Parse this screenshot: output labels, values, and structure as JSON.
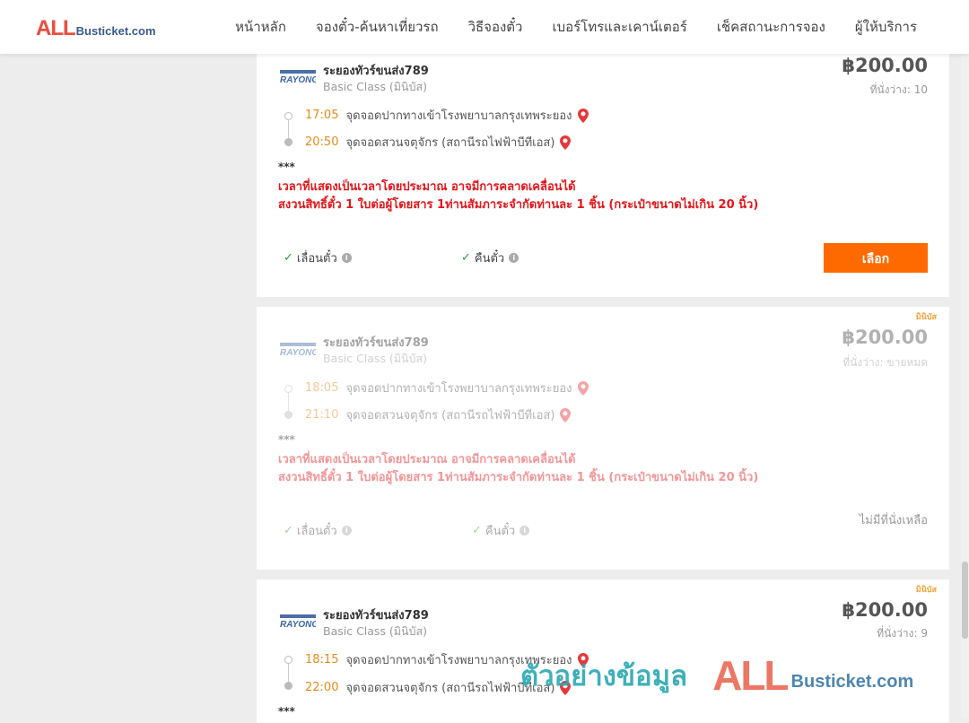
{
  "header": {
    "logo_main": "ALL",
    "logo_rest": "Busticket.com",
    "nav": [
      "หน้าหลัก",
      "จองตั๋ว-ค้นหาเที่ยวรถ",
      "วิธีจองตั๋ว",
      "เบอร์โทรและเคาน์เตอร์",
      "เช็คสถานะการจอง",
      "ผู้ให้บริการ"
    ]
  },
  "trips": [
    {
      "badge": "",
      "operator": "ระยองทัวร์ขนส่ง789",
      "operator_logo": "RAYONG",
      "class": "Basic Class (มินิบัส)",
      "price": "฿200.00",
      "seats": "ที่นั่งว่าง: 10",
      "depart_time": "17:05",
      "depart_place": "จุดจอดปากทางเข้าโรงพยาบาลกรุงเทพระยอง",
      "arrive_time": "20:50",
      "arrive_place": "จุดจอดสวนจตุจักร (สถานีรถไฟฟ้าบีทีเอส)",
      "stars": "***",
      "notice_1": "เวลาที่แสดงเป็นเวลาโดยประมาณ อาจมีการคลาดเคลื่อนได้",
      "notice_2": "สงวนสิทธิ์ตั๋ว 1 ใบต่อผู้โดยสาร 1ท่านสัมภาระจำกัดท่านละ 1 ชิ้น (กระเป๋าขนาดไม่เกิน 20 นิ้ว)",
      "feature_1": "เลื่อนตั๋ว",
      "feature_2": "คืนตั๋ว",
      "action": "เลือก"
    },
    {
      "badge": "มินิบัส",
      "operator": "ระยองทัวร์ขนส่ง789",
      "operator_logo": "RAYONG",
      "class": "Basic Class (มินิบัส)",
      "price": "฿200.00",
      "seats": "ที่นั่งว่าง: ขายหมด",
      "depart_time": "18:05",
      "depart_place": "จุดจอดปากทางเข้าโรงพยาบาลกรุงเทพระยอง",
      "arrive_time": "21:10",
      "arrive_place": "จุดจอดสวนจตุจักร (สถานีรถไฟฟ้าบีทีเอส)",
      "stars": "***",
      "notice_1": "เวลาที่แสดงเป็นเวลาโดยประมาณ อาจมีการคลาดเคลื่อนได้",
      "notice_2": "สงวนสิทธิ์ตั๋ว 1 ใบต่อผู้โดยสาร 1ท่านสัมภาระจำกัดท่านละ 1 ชิ้น (กระเป๋าขนาดไม่เกิน 20 นิ้ว)",
      "feature_1": "เลื่อนตั๋ว",
      "feature_2": "คืนตั๋ว",
      "action": "ไม่มีที่นั่งเหลือ"
    },
    {
      "badge": "มินิบัส",
      "operator": "ระยองทัวร์ขนส่ง789",
      "operator_logo": "RAYONG",
      "class": "Basic Class (มินิบัส)",
      "price": "฿200.00",
      "seats": "ที่นั่งว่าง: 9",
      "depart_time": "18:15",
      "depart_place": "จุดจอดปากทางเข้าโรงพยาบาลกรุงเทพระยอง",
      "arrive_time": "22:00",
      "arrive_place": "จุดจอดสวนจตุจักร (สถานีรถไฟฟ้าบีทีเอส)",
      "stars": "***"
    }
  ],
  "watermark": {
    "thai": "ตัวอย่างข้อมูล",
    "brand_main": "ALL",
    "brand_rest": "Busticket.com"
  },
  "colors": {
    "accent": "#ff6a00",
    "notice": "#e3161a",
    "time": "#e88a1a",
    "check": "#2e9a3a"
  }
}
